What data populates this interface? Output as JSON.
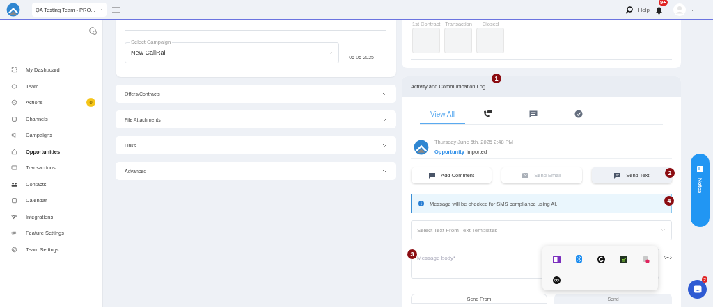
{
  "topbar": {
    "team_selector": "QA Testing Team - PRO...",
    "help": "Help",
    "notification_count": "9+"
  },
  "sidebar": {
    "items": [
      {
        "label": "My Dashboard",
        "selected": false
      },
      {
        "label": "Team",
        "selected": false
      },
      {
        "label": "Actions",
        "selected": false,
        "badge": "0"
      },
      {
        "label": "Channels",
        "selected": false
      },
      {
        "label": "Campaigns",
        "selected": false
      },
      {
        "label": "Opportunities",
        "selected": true
      },
      {
        "label": "Transactions",
        "selected": false
      },
      {
        "label": "Contacts",
        "selected": false
      },
      {
        "label": "Calendar",
        "selected": false
      },
      {
        "label": "Integrations",
        "selected": false
      },
      {
        "label": "Feature Settings",
        "selected": false
      },
      {
        "label": "Team Settings",
        "selected": false
      }
    ]
  },
  "campaign": {
    "label": "Select Campaign",
    "value": "New CallRail",
    "date": "06-05-2025"
  },
  "sections": [
    {
      "title": "Offers/Contracts",
      "expanded": false
    },
    {
      "title": "File Attachments",
      "expanded": false
    },
    {
      "title": "Links",
      "expanded": false
    },
    {
      "title": "Advanced",
      "expanded": false
    }
  ],
  "stages": [
    "1st Contract",
    "Transaction",
    "Closed"
  ],
  "activity_log": {
    "title": "Activity and Communication Log",
    "tabs": [
      {
        "kind": "text",
        "label": "View All",
        "selected": true
      },
      {
        "kind": "calls",
        "selected": false
      },
      {
        "kind": "messages",
        "selected": false
      },
      {
        "kind": "tasks",
        "selected": false
      }
    ],
    "entry": {
      "time": "Thursday June 5th, 2025 2:48 PM",
      "link": "Opportunity",
      "text": "imported"
    },
    "actions": [
      {
        "kind": "comment",
        "label": "Add Comment",
        "disabled": false,
        "selected": false
      },
      {
        "kind": "email",
        "label": "Send Email",
        "disabled": true,
        "selected": false
      },
      {
        "kind": "text",
        "label": "Send Text",
        "disabled": false,
        "selected": true
      }
    ],
    "notice": "Message will be checked for SMS compliance using AI.",
    "template_placeholder": "Select Text From Text Templates",
    "message_placeholder": "Message body*",
    "send_from": "Send From",
    "send": "Send"
  },
  "notes_tab": "Notes",
  "chat_badge": "2",
  "annotations": [
    "1",
    "2",
    "3",
    "4"
  ]
}
